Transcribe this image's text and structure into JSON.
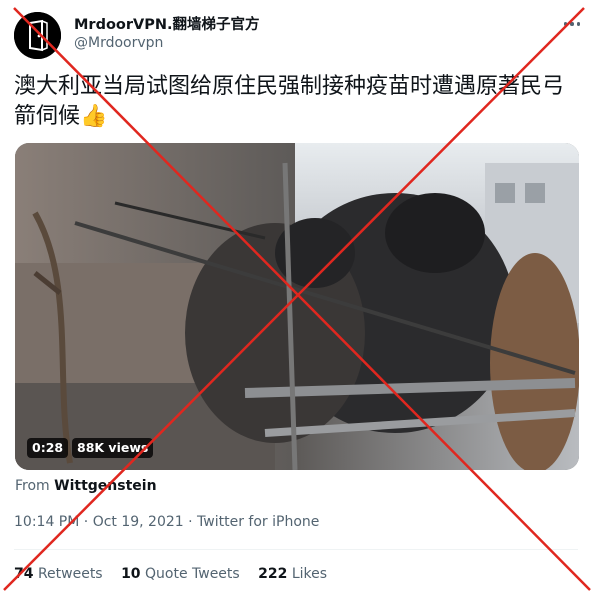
{
  "author": {
    "display_name": "MrdoorVPN.翻墙梯子官方",
    "handle": "@Mrdoorvpn"
  },
  "tweet": {
    "text": "澳大利亚当局试图给原住民强制接种疫苗时遭遇原著民弓箭伺候👍"
  },
  "media": {
    "duration": "0:28",
    "views": "88K views"
  },
  "attribution": {
    "prefix": "From",
    "source": "Wittgenstein"
  },
  "meta": {
    "time": "10:14 PM",
    "date": "Oct 19, 2021",
    "separator": "·",
    "client": "Twitter for iPhone"
  },
  "stats": {
    "retweets": {
      "count": "74",
      "label": "Retweets"
    },
    "quotes": {
      "count": "10",
      "label": "Quote Tweets"
    },
    "likes": {
      "count": "222",
      "label": "Likes"
    }
  },
  "colors": {
    "cross": "#e0271f",
    "secondary_text": "#536471",
    "primary_text": "#0f1419"
  },
  "icons": {
    "more": "more-horizontal-icon",
    "avatar_logo": "door-logo-icon"
  }
}
